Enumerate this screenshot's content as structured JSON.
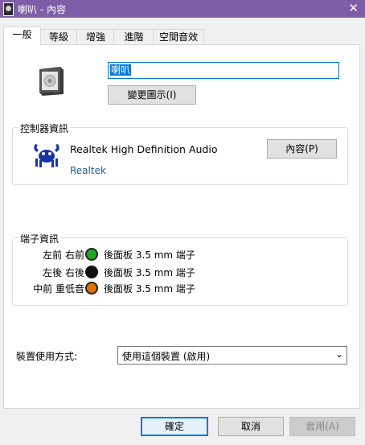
{
  "window": {
    "title": "喇叭 - 內容"
  },
  "tabs": [
    "一般",
    "等級",
    "增強",
    "進階",
    "空間音效"
  ],
  "general": {
    "name_value": "喇叭",
    "change_icon_label": "變更圖示(I)"
  },
  "controller": {
    "legend": "控制器資訊",
    "device_name": "Realtek High Definition Audio",
    "vendor": "Realtek",
    "properties_label": "內容(P)"
  },
  "jacks": {
    "legend": "端子資訊",
    "items": [
      {
        "label": "左前 右前",
        "desc": "後面板 3.5 mm 端子",
        "color": "#1fa824"
      },
      {
        "label": "左後 右後",
        "desc": "後面板 3.5 mm 端子",
        "color": "#111111"
      },
      {
        "label": "中前 重低音",
        "desc": "後面板 3.5 mm 端子",
        "color": "#e07000"
      }
    ]
  },
  "device_usage": {
    "label": "裝置使用方式:",
    "selected": "使用這個裝置 (啟用)"
  },
  "buttons": {
    "ok": "確定",
    "cancel": "取消",
    "apply": "套用(A)"
  }
}
